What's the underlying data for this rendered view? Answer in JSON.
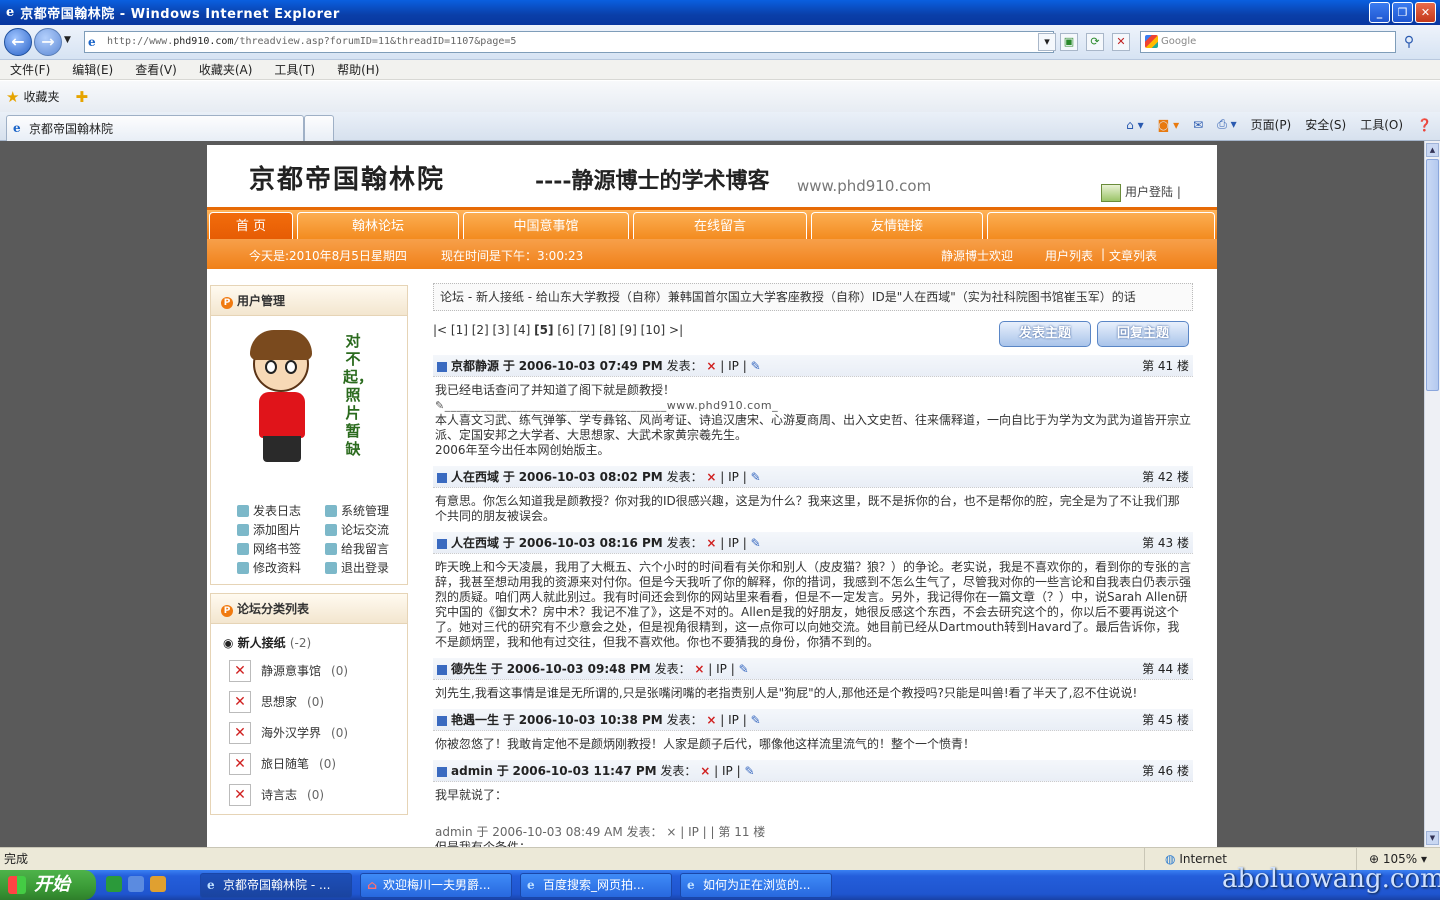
{
  "window": {
    "title": "京都帝国翰林院 - Windows Internet Explorer"
  },
  "address": {
    "prefix": "http://www.",
    "host": "phd910.com",
    "path": "/threadview.asp?forumID=11&threadID=1107&page=5"
  },
  "search": {
    "placeholder": "Google"
  },
  "menu": [
    "文件(F)",
    "编辑(E)",
    "查看(V)",
    "收藏夹(A)",
    "工具(T)",
    "帮助(H)"
  ],
  "favbar": {
    "label": "收藏夹"
  },
  "tab": {
    "label": "京都帝国翰林院"
  },
  "cmdbar": {
    "page": "页面(P)",
    "safety": "安全(S)",
    "tools": "工具(O)"
  },
  "site": {
    "title": "京都帝国翰林院",
    "subtitle": "----静源博士的学术博客",
    "url": "www.phd910.com",
    "login": "用户登陆"
  },
  "nav": [
    "首 页",
    "翰林论坛",
    "中国意事馆",
    "在线留言",
    "友情链接"
  ],
  "strip": {
    "date": "今天是:2010年8月5日星期四",
    "time": "现在时间是下午：3:00:23",
    "welcome": "静源博士欢迎",
    "users": "用户列表",
    "articles": "文章列表"
  },
  "sidebar": {
    "user_title": "用户管理",
    "photo_text": "对不起，照片暂缺",
    "links": [
      "发表日志",
      "系统管理",
      "添加图片",
      "论坛交流",
      "网络书签",
      "给我留言",
      "修改资料",
      "退出登录"
    ],
    "cat_title": "论坛分类列表",
    "cat_top": "新人接纸",
    "cat_top_count": "(-2)",
    "categories": [
      {
        "name": "静源意事馆",
        "count": "(0)"
      },
      {
        "name": "思想家",
        "count": "(0)"
      },
      {
        "name": "海外汉学界",
        "count": "(0)"
      },
      {
        "name": "旅日随笔",
        "count": "(0)"
      },
      {
        "name": "诗言志",
        "count": "(0)"
      }
    ]
  },
  "crumb": "论坛 - 新人接纸 - 给山东大学教授（自称）兼韩国首尔国立大学客座教授（自称）ID是\"人在西域\"（实为社科院图书馆崔玉军）的话",
  "pager": {
    "text": "|< [1] [2] [3] [4] ",
    "current": "[5]",
    "rest": " [6] [7] [8] [9] [10] >|",
    "post_btn": "发表主题",
    "reply_btn": "回复主题"
  },
  "posts": [
    {
      "author": "京都静源",
      "at": "于",
      "time": "2006-10-03 07:49 PM",
      "said": "发表：",
      "floor": "第 41 楼",
      "body": [
        "我已经电话查问了并知道了阁下就是颜教授！"
      ],
      "sig": "_____________________________________www.phd910.com_",
      "extra": [
        "本人喜文习武、练气弹筝、学专彝铭、风尚考证、诗追汉唐宋、心游夏商周、出入文史哲、往来儒释道，一向自比于为学为文为武为道皆开宗立派、定国安邦之大学者、大思想家、大武术家黄宗羲先生。",
        "2006年至今出任本网创始版主。"
      ]
    },
    {
      "author": "人在西域",
      "at": "于",
      "time": "2006-10-03 08:02 PM",
      "said": "发表：",
      "floor": "第 42 楼",
      "body": [
        "有意思。你怎么知道我是颜教授？你对我的ID很感兴趣，这是为什么？我来这里，既不是拆你的台，也不是帮你的腔，完全是为了不让我们那个共同的朋友被误会。"
      ]
    },
    {
      "author": "人在西域",
      "at": "于",
      "time": "2006-10-03 08:16 PM",
      "said": "发表：",
      "floor": "第 43 楼",
      "body": [
        "昨天晚上和今天凌晨，我用了大概五、六个小时的时间看有关你和别人（皮皮猫？狼？）的争论。老实说，我是不喜欢你的，看到你的专张的言辞，我甚至想动用我的资源来对付你。但是今天我听了你的解释，你的措词，我感到不怎么生气了，尽管我对你的一些言论和自我表白仍表示强烈的质疑。咱们两人就此别过。我有时间还会到你的网站里来看看，但是不一定发言。另外，我记得你在一篇文章（？）中，说Sarah Allen研究中国的《御女术？房中术？我记不准了》，这是不对的。Allen是我的好朋友，她很反感这个东西，不会去研究这个的，你以后不要再说这个了。她对三代的研究有不少意会之处，但是视角很精到，这一点你可以向她交流。她目前已经从Dartmouth转到Havard了。最后告诉你，我不是颜炳罡，我和他有过交往，但我不喜欢他。你也不要猜我的身份，你猜不到的。"
      ]
    },
    {
      "author": "德先生",
      "at": "于",
      "time": "2006-10-03 09:48 PM",
      "said": "发表：",
      "floor": "第 44 楼",
      "body": [
        "刘先生,我看这事情是谁是无所谓的,只是张嘴闭嘴的老指责别人是\"狗屁\"的人,那他还是个教授吗?只能是叫兽!看了半天了,忍不住说说!"
      ]
    },
    {
      "author": "艳遇一生",
      "at": "于",
      "time": "2006-10-03 10:38 PM",
      "said": "发表：",
      "floor": "第 45 楼",
      "body": [
        "你被忽悠了！我敢肯定他不是颜炳刚教授！人家是颜子后代，哪像他这样流里流气的！整个一个愤青！"
      ]
    },
    {
      "author": "admin",
      "at": "于",
      "time": "2006-10-03 11:47 PM",
      "said": "发表：",
      "floor": "第 46 楼",
      "body": [
        "我早就说了："
      ],
      "quote": "admin 于 2006-10-03 08:49 AM 发表：  ×  |  IP  |  | 第 11 楼",
      "quote2": "但是我有个条件："
    }
  ],
  "status": {
    "left": "完成",
    "zone": "Internet",
    "zoom": "105%"
  },
  "taskbar": {
    "start": "开始",
    "items": [
      "京都帝国翰林院 - ...",
      "欢迎梅川一夫男爵...",
      "百度搜索_网页拍...",
      "如何为正在浏览的..."
    ]
  },
  "watermark": "aboluowang.com"
}
